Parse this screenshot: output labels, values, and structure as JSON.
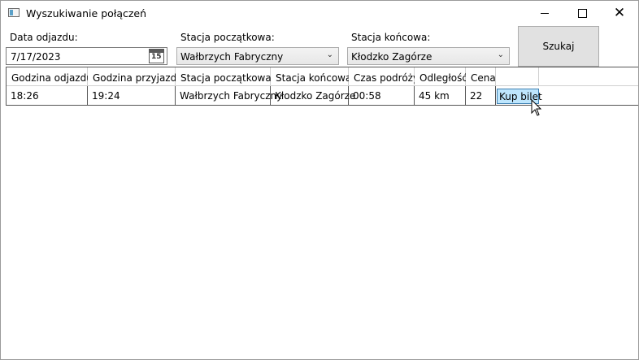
{
  "window": {
    "title": "Wyszukiwanie połączeń",
    "icon": "app-window-icon",
    "controls": [
      "minimize-icon",
      "maximize-icon",
      "close-icon"
    ]
  },
  "form": {
    "date_label": "Data odjazdu:",
    "date_value": "7/17/2023",
    "calendar_day": "15",
    "start_label": "Stacja początkowa:",
    "start_value": "Wałbrzych Fabryczny",
    "end_label": "Stacja końcowa:",
    "end_value": "Kłodzko Zagórze",
    "search_label": "Szukaj"
  },
  "table": {
    "headers": [
      "Godzina odjazdu",
      "Godzina przyjazdu",
      "Stacja początkowa",
      "Stacja końcowa",
      "Czas podróży",
      "Odległość",
      "Cena"
    ],
    "rows": [
      {
        "cells": [
          "18:26",
          "19:24",
          "Wałbrzych Fabryczny",
          "Kłodzko Zagórze",
          "00:58",
          "45 km",
          "22"
        ],
        "action": "Kup bilet"
      }
    ]
  },
  "colors": {
    "button_bg": "#e1e1e1",
    "buy_button_bg": "#bee6fd",
    "buy_button_border": "#3c7fb1"
  }
}
